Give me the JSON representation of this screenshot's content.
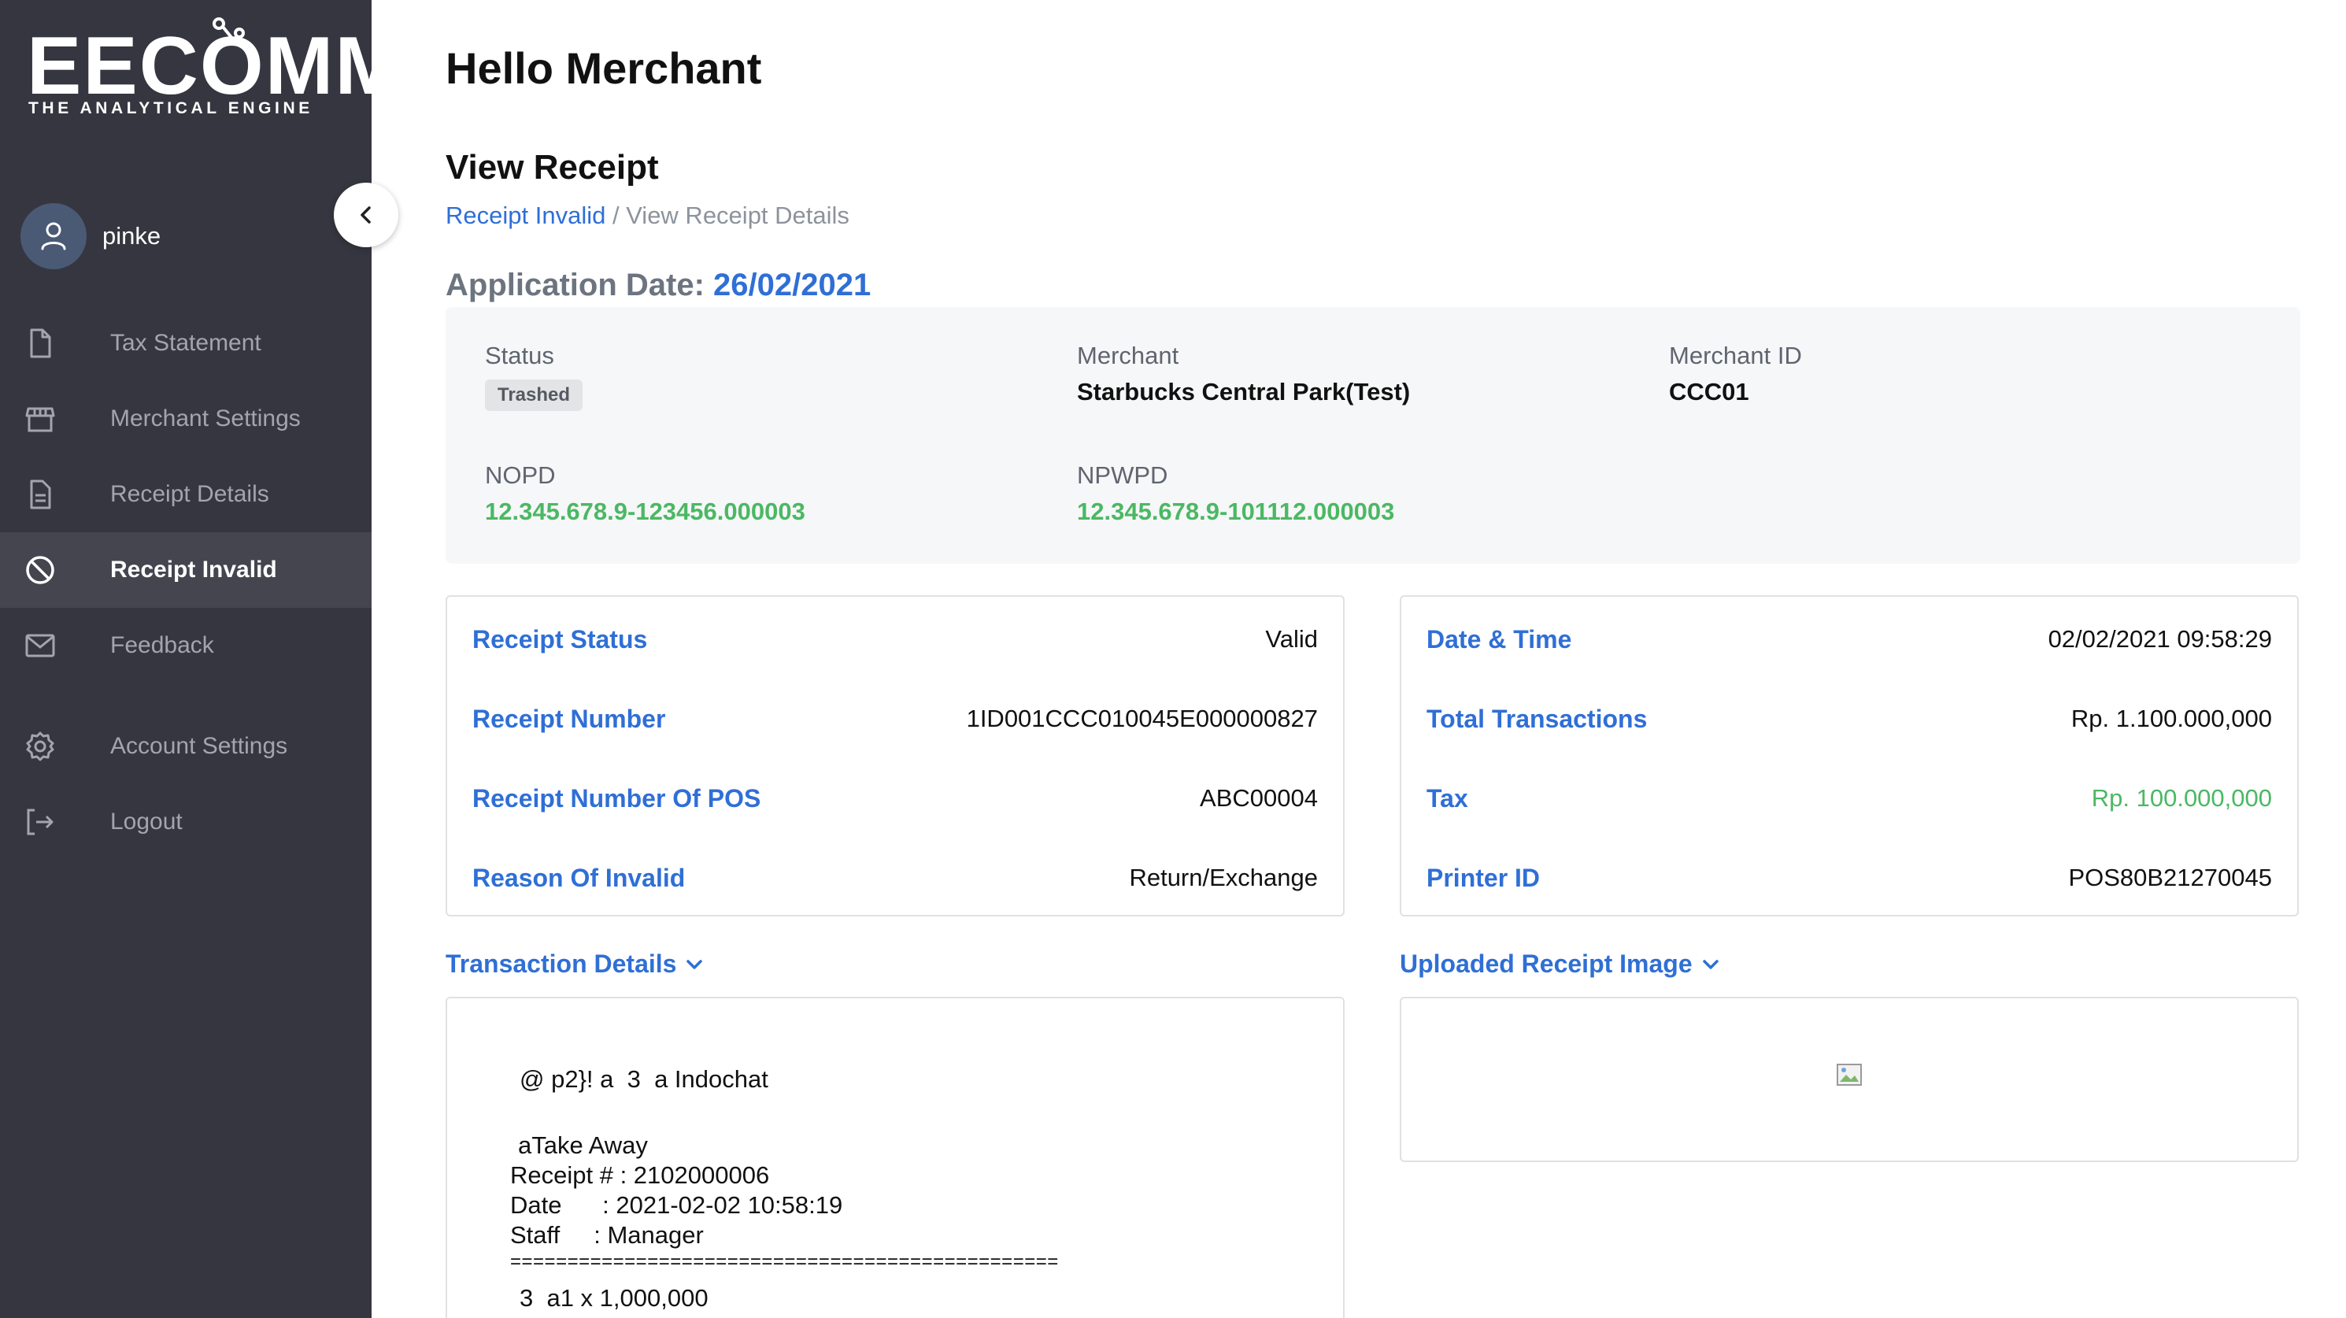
{
  "brand": {
    "name": "EECOMM",
    "tagline": "THE ANALYTICAL ENGINE"
  },
  "user": {
    "name": "pinke"
  },
  "sidebar": {
    "items": [
      {
        "label": "Tax Statement",
        "icon": "file-icon"
      },
      {
        "label": "Merchant Settings",
        "icon": "store-icon"
      },
      {
        "label": "Receipt Details",
        "icon": "document-icon"
      },
      {
        "label": "Receipt Invalid",
        "icon": "ban-icon",
        "active": true
      },
      {
        "label": "Feedback",
        "icon": "mail-icon"
      },
      {
        "label": "Account Settings",
        "icon": "gear-icon"
      },
      {
        "label": "Logout",
        "icon": "logout-icon"
      }
    ]
  },
  "header": {
    "greeting": "Hello Merchant",
    "title": "View Receipt",
    "breadcrumb": {
      "link": "Receipt Invalid",
      "separator": " / ",
      "current": "View Receipt Details"
    },
    "application_date_label": "Application Date: ",
    "application_date": "26/02/2021"
  },
  "summary": {
    "status_label": "Status",
    "status_value": "Trashed",
    "merchant_label": "Merchant",
    "merchant_value": "Starbucks Central Park(Test)",
    "merchant_id_label": "Merchant ID",
    "merchant_id_value": "CCC01",
    "nopd_label": "NOPD",
    "nopd_value": "12.345.678.9-123456.000003",
    "npwpd_label": "NPWPD",
    "npwpd_value": "12.345.678.9-101112.000003"
  },
  "receipt_info": {
    "rows": [
      {
        "label": "Receipt Status",
        "value": "Valid"
      },
      {
        "label": "Receipt Number",
        "value": "1ID001CCC010045E000000827"
      },
      {
        "label": "Receipt Number Of POS",
        "value": "ABC00004"
      },
      {
        "label": "Reason Of Invalid",
        "value": "Return/Exchange"
      }
    ]
  },
  "transaction_info": {
    "rows": [
      {
        "label": "Date & Time",
        "value": "02/02/2021 09:58:29"
      },
      {
        "label": "Total Transactions",
        "value": "Rp. 1.100.000,000"
      },
      {
        "label": "Tax",
        "value": "Rp. 100.000,000"
      },
      {
        "label": "Printer ID",
        "value": "POS80B21270045"
      }
    ]
  },
  "transaction_details": {
    "title": "Transaction Details",
    "lines": [
      "@ p2}! a  3  a Indochat",
      "aTake Away",
      "Receipt # : 2102000006",
      "Date      : 2021-02-02 10:58:19",
      "Staff     : Manager",
      "================================================",
      "3  a1 x 1,000,000"
    ]
  },
  "uploaded_image": {
    "title": "Uploaded Receipt Image"
  },
  "colors": {
    "sidebar_bg": "#363640",
    "accent_blue": "#2f6fd6",
    "green": "#4bb863"
  }
}
